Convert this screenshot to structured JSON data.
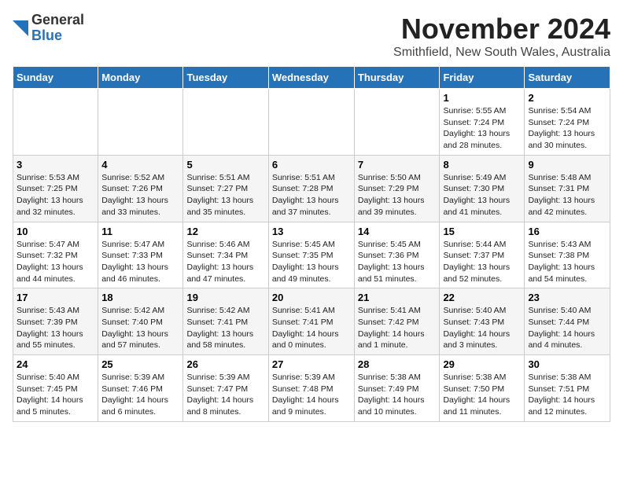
{
  "header": {
    "logo_general": "General",
    "logo_blue": "Blue",
    "title": "November 2024",
    "subtitle": "Smithfield, New South Wales, Australia"
  },
  "calendar": {
    "weekdays": [
      "Sunday",
      "Monday",
      "Tuesday",
      "Wednesday",
      "Thursday",
      "Friday",
      "Saturday"
    ],
    "weeks": [
      [
        {
          "day": "",
          "info": ""
        },
        {
          "day": "",
          "info": ""
        },
        {
          "day": "",
          "info": ""
        },
        {
          "day": "",
          "info": ""
        },
        {
          "day": "",
          "info": ""
        },
        {
          "day": "1",
          "info": "Sunrise: 5:55 AM\nSunset: 7:24 PM\nDaylight: 13 hours\nand 28 minutes."
        },
        {
          "day": "2",
          "info": "Sunrise: 5:54 AM\nSunset: 7:24 PM\nDaylight: 13 hours\nand 30 minutes."
        }
      ],
      [
        {
          "day": "3",
          "info": "Sunrise: 5:53 AM\nSunset: 7:25 PM\nDaylight: 13 hours\nand 32 minutes."
        },
        {
          "day": "4",
          "info": "Sunrise: 5:52 AM\nSunset: 7:26 PM\nDaylight: 13 hours\nand 33 minutes."
        },
        {
          "day": "5",
          "info": "Sunrise: 5:51 AM\nSunset: 7:27 PM\nDaylight: 13 hours\nand 35 minutes."
        },
        {
          "day": "6",
          "info": "Sunrise: 5:51 AM\nSunset: 7:28 PM\nDaylight: 13 hours\nand 37 minutes."
        },
        {
          "day": "7",
          "info": "Sunrise: 5:50 AM\nSunset: 7:29 PM\nDaylight: 13 hours\nand 39 minutes."
        },
        {
          "day": "8",
          "info": "Sunrise: 5:49 AM\nSunset: 7:30 PM\nDaylight: 13 hours\nand 41 minutes."
        },
        {
          "day": "9",
          "info": "Sunrise: 5:48 AM\nSunset: 7:31 PM\nDaylight: 13 hours\nand 42 minutes."
        }
      ],
      [
        {
          "day": "10",
          "info": "Sunrise: 5:47 AM\nSunset: 7:32 PM\nDaylight: 13 hours\nand 44 minutes."
        },
        {
          "day": "11",
          "info": "Sunrise: 5:47 AM\nSunset: 7:33 PM\nDaylight: 13 hours\nand 46 minutes."
        },
        {
          "day": "12",
          "info": "Sunrise: 5:46 AM\nSunset: 7:34 PM\nDaylight: 13 hours\nand 47 minutes."
        },
        {
          "day": "13",
          "info": "Sunrise: 5:45 AM\nSunset: 7:35 PM\nDaylight: 13 hours\nand 49 minutes."
        },
        {
          "day": "14",
          "info": "Sunrise: 5:45 AM\nSunset: 7:36 PM\nDaylight: 13 hours\nand 51 minutes."
        },
        {
          "day": "15",
          "info": "Sunrise: 5:44 AM\nSunset: 7:37 PM\nDaylight: 13 hours\nand 52 minutes."
        },
        {
          "day": "16",
          "info": "Sunrise: 5:43 AM\nSunset: 7:38 PM\nDaylight: 13 hours\nand 54 minutes."
        }
      ],
      [
        {
          "day": "17",
          "info": "Sunrise: 5:43 AM\nSunset: 7:39 PM\nDaylight: 13 hours\nand 55 minutes."
        },
        {
          "day": "18",
          "info": "Sunrise: 5:42 AM\nSunset: 7:40 PM\nDaylight: 13 hours\nand 57 minutes."
        },
        {
          "day": "19",
          "info": "Sunrise: 5:42 AM\nSunset: 7:41 PM\nDaylight: 13 hours\nand 58 minutes."
        },
        {
          "day": "20",
          "info": "Sunrise: 5:41 AM\nSunset: 7:41 PM\nDaylight: 14 hours\nand 0 minutes."
        },
        {
          "day": "21",
          "info": "Sunrise: 5:41 AM\nSunset: 7:42 PM\nDaylight: 14 hours\nand 1 minute."
        },
        {
          "day": "22",
          "info": "Sunrise: 5:40 AM\nSunset: 7:43 PM\nDaylight: 14 hours\nand 3 minutes."
        },
        {
          "day": "23",
          "info": "Sunrise: 5:40 AM\nSunset: 7:44 PM\nDaylight: 14 hours\nand 4 minutes."
        }
      ],
      [
        {
          "day": "24",
          "info": "Sunrise: 5:40 AM\nSunset: 7:45 PM\nDaylight: 14 hours\nand 5 minutes."
        },
        {
          "day": "25",
          "info": "Sunrise: 5:39 AM\nSunset: 7:46 PM\nDaylight: 14 hours\nand 6 minutes."
        },
        {
          "day": "26",
          "info": "Sunrise: 5:39 AM\nSunset: 7:47 PM\nDaylight: 14 hours\nand 8 minutes."
        },
        {
          "day": "27",
          "info": "Sunrise: 5:39 AM\nSunset: 7:48 PM\nDaylight: 14 hours\nand 9 minutes."
        },
        {
          "day": "28",
          "info": "Sunrise: 5:38 AM\nSunset: 7:49 PM\nDaylight: 14 hours\nand 10 minutes."
        },
        {
          "day": "29",
          "info": "Sunrise: 5:38 AM\nSunset: 7:50 PM\nDaylight: 14 hours\nand 11 minutes."
        },
        {
          "day": "30",
          "info": "Sunrise: 5:38 AM\nSunset: 7:51 PM\nDaylight: 14 hours\nand 12 minutes."
        }
      ]
    ]
  }
}
